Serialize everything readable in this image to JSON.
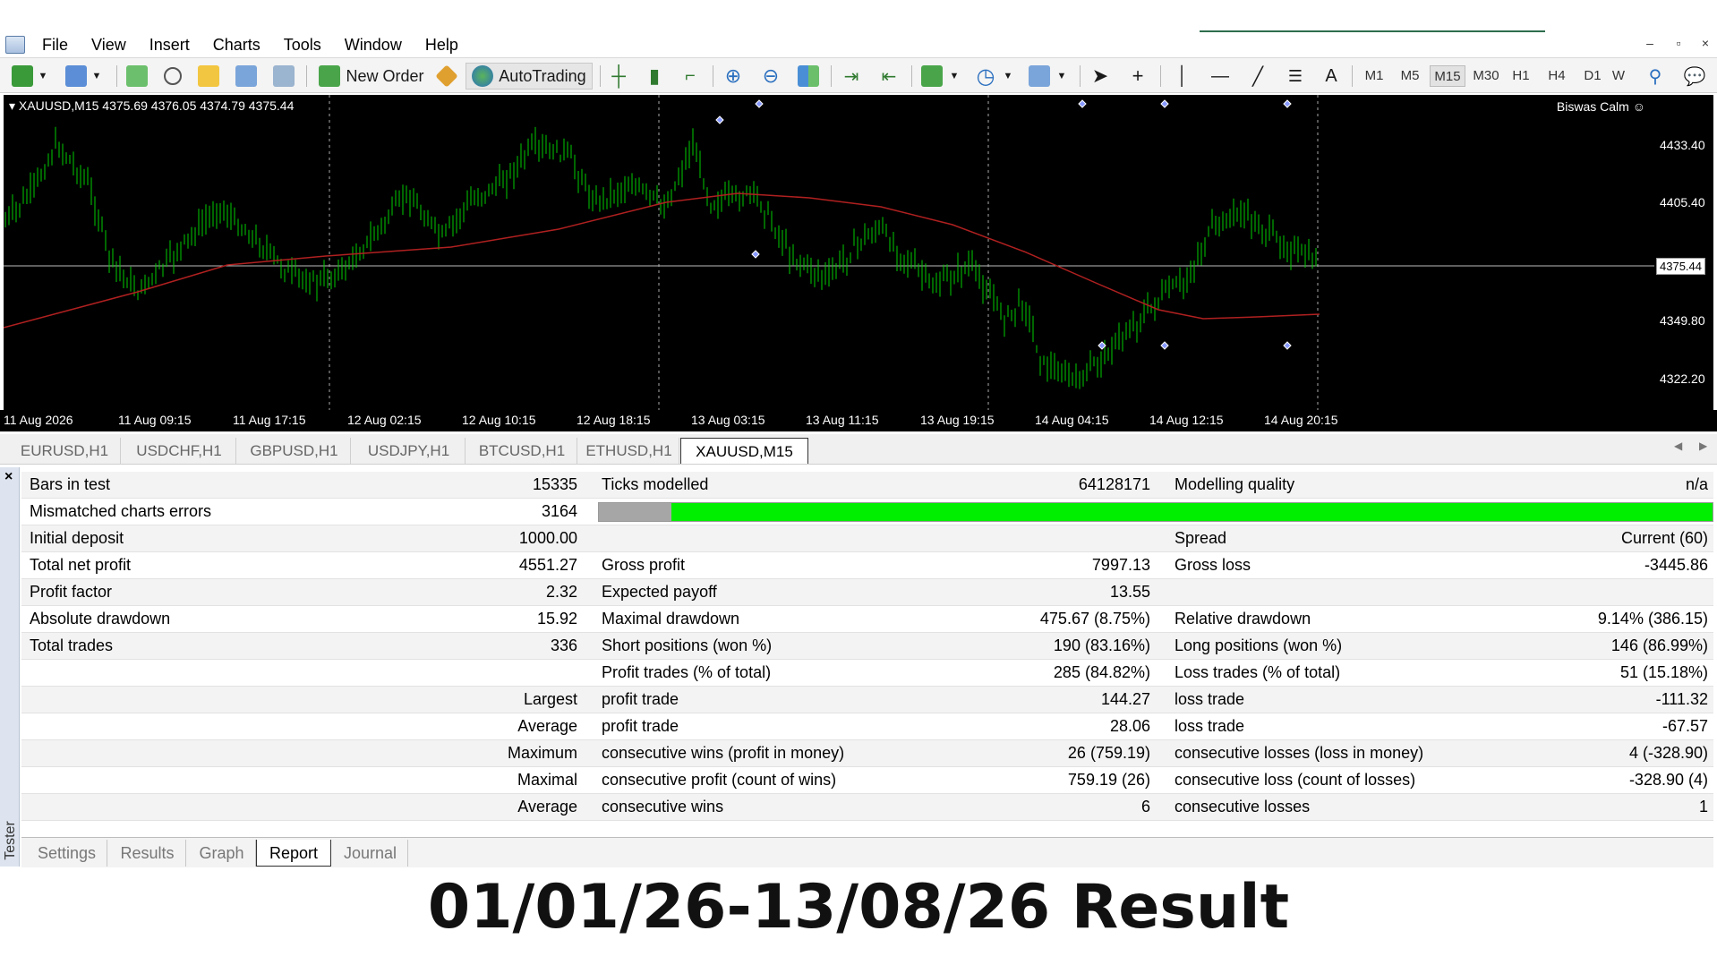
{
  "menu": {
    "items": [
      "File",
      "View",
      "Insert",
      "Charts",
      "Tools",
      "Window",
      "Help"
    ],
    "window_controls": [
      "–",
      "▫",
      "×"
    ]
  },
  "toolbar": {
    "new_order_label": "New Order",
    "autotrading_label": "AutoTrading",
    "text_tool_label": "A",
    "timeframes": [
      "M1",
      "M5",
      "M15",
      "M30",
      "H1",
      "H4",
      "D1",
      "W"
    ],
    "active_timeframe": "M15",
    "icons": [
      "new-chart-icon",
      "profiles-icon",
      "market-watch-icon",
      "navigator-icon",
      "favorites-icon",
      "data-window-icon",
      "strategy-tester-icon",
      "new-order-icon",
      "metaeditor-icon",
      "autotrading-icon",
      "bar-chart-icon",
      "candlestick-icon",
      "line-chart-icon",
      "zoom-in-icon",
      "zoom-out-icon",
      "tile-windows-icon",
      "autoscroll-icon",
      "chart-shift-icon",
      "indicators-icon",
      "periods-icon",
      "templates-icon",
      "cursor-icon",
      "crosshair-icon",
      "vertical-line-icon",
      "horizontal-line-icon",
      "trendline-icon",
      "fibonacci-icon",
      "text-icon",
      "search-icon",
      "chat-icon"
    ]
  },
  "chart": {
    "title": "XAUUSD,M15  4375.69 4376.05 4374.79 4375.44",
    "ea_name": "Biswas Calm",
    "smiley": "☺",
    "price_labels": [
      "4433.40",
      "4405.40",
      "4349.80",
      "4322.20"
    ],
    "current_price": "4375.44",
    "time_labels": [
      "11 Aug 2026",
      "11 Aug 09:15",
      "11 Aug 17:15",
      "12 Aug 02:15",
      "12 Aug 10:15",
      "12 Aug 18:15",
      "13 Aug 03:15",
      "13 Aug 11:15",
      "13 Aug 19:15",
      "14 Aug 04:15",
      "14 Aug 12:15",
      "14 Aug 20:15"
    ],
    "candle_color": "#00cc00",
    "ma_color": "#b02020",
    "background": "#000000"
  },
  "chart_tabs": {
    "items": [
      "EURUSD,H1",
      "USDCHF,H1",
      "GBPUSD,H1",
      "USDJPY,H1",
      "BTCUSD,H1",
      "ETHUSD,H1",
      "XAUUSD,M15"
    ],
    "active": "XAUUSD,M15"
  },
  "tester": {
    "close_label": "×",
    "side_label": "Tester"
  },
  "report": {
    "rows": [
      {
        "l1": "Bars in test",
        "v1": "15335",
        "l2": "Ticks modelled",
        "v2": "64128171",
        "l3": "Modelling quality",
        "v3": "n/a"
      },
      {
        "l1": "Mismatched charts errors",
        "v1": "3164",
        "l2": "",
        "v2": "",
        "l3": "",
        "v3": ""
      },
      {
        "l1": "Initial deposit",
        "v1": "1000.00",
        "l2": "",
        "v2": "",
        "l3": "Spread",
        "v3": "Current (60)"
      },
      {
        "l1": "Total net profit",
        "v1": "4551.27",
        "l2": "Gross profit",
        "v2": "7997.13",
        "l3": "Gross loss",
        "v3": "-3445.86"
      },
      {
        "l1": "Profit factor",
        "v1": "2.32",
        "l2": "Expected payoff",
        "v2": "13.55",
        "l3": "",
        "v3": ""
      },
      {
        "l1": "Absolute drawdown",
        "v1": "15.92",
        "l2": "Maximal drawdown",
        "v2": "475.67 (8.75%)",
        "l3": "Relative drawdown",
        "v3": "9.14% (386.15)"
      },
      {
        "l1": "Total trades",
        "v1": "336",
        "l2": "Short positions (won %)",
        "v2": "190 (83.16%)",
        "l3": "Long positions (won %)",
        "v3": "146 (86.99%)"
      },
      {
        "l1": "",
        "v1": "",
        "l2": "Profit trades (% of total)",
        "v2": "285 (84.82%)",
        "l3": "Loss trades (% of total)",
        "v3": "51 (15.18%)"
      },
      {
        "l1": "",
        "v1": "Largest",
        "l2": "profit trade",
        "v2": "144.27",
        "l3": "loss trade",
        "v3": "-111.32"
      },
      {
        "l1": "",
        "v1": "Average",
        "l2": "profit trade",
        "v2": "28.06",
        "l3": "loss trade",
        "v3": "-67.57"
      },
      {
        "l1": "",
        "v1": "Maximum",
        "l2": "consecutive wins (profit in money)",
        "v2": "26 (759.19)",
        "l3": "consecutive losses (loss in money)",
        "v3": "4 (-328.90)"
      },
      {
        "l1": "",
        "v1": "Maximal",
        "l2": "consecutive profit (count of wins)",
        "v2": "759.19 (26)",
        "l3": "consecutive loss (count of losses)",
        "v3": "-328.90 (4)"
      },
      {
        "l1": "",
        "v1": "Average",
        "l2": "consecutive wins",
        "v2": "6",
        "l3": "consecutive losses",
        "v3": "1"
      }
    ],
    "mismatch_fraction": 0.065
  },
  "bottom_tabs": {
    "items": [
      "Settings",
      "Results",
      "Graph",
      "Report",
      "Journal"
    ],
    "active": "Report"
  },
  "caption": "01/01/26-13/08/26 Result"
}
